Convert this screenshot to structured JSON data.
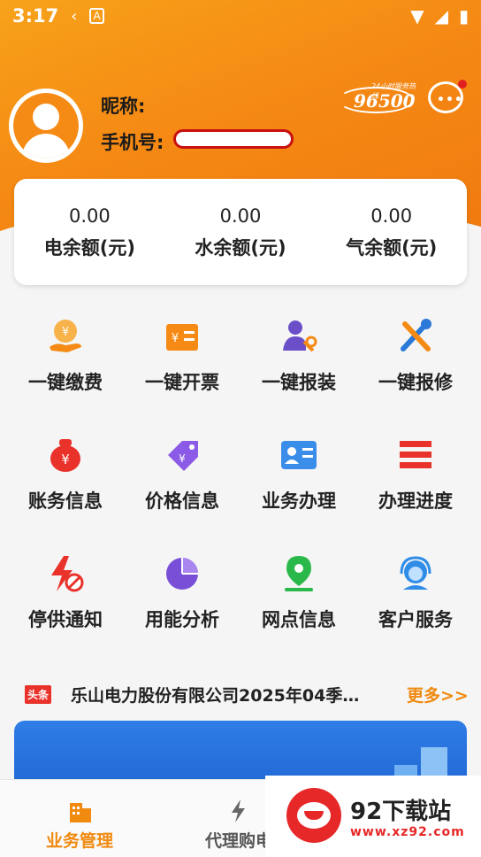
{
  "status_bar": {
    "time": "3:17",
    "notif_icon_a": "A"
  },
  "profile": {
    "nickname_label": "昵称:",
    "phone_label": "手机号:"
  },
  "hotline": {
    "small_text": "24小时服务热线",
    "number": "96500"
  },
  "balances": [
    {
      "value": "0.00",
      "label": "电余额(元)"
    },
    {
      "value": "0.00",
      "label": "水余额(元)"
    },
    {
      "value": "0.00",
      "label": "气余额(元)"
    }
  ],
  "grid": [
    {
      "label": "一键缴费",
      "icon": "payment-icon"
    },
    {
      "label": "一键开票",
      "icon": "invoice-icon"
    },
    {
      "label": "一键报装",
      "icon": "install-icon"
    },
    {
      "label": "一键报修",
      "icon": "repair-icon"
    },
    {
      "label": "账务信息",
      "icon": "bill-icon"
    },
    {
      "label": "价格信息",
      "icon": "price-tag-icon"
    },
    {
      "label": "业务办理",
      "icon": "id-card-icon"
    },
    {
      "label": "办理进度",
      "icon": "progress-list-icon"
    },
    {
      "label": "停供通知",
      "icon": "power-off-icon"
    },
    {
      "label": "用能分析",
      "icon": "pie-chart-icon"
    },
    {
      "label": "网点信息",
      "icon": "location-pin-icon"
    },
    {
      "label": "客户服务",
      "icon": "headset-icon"
    }
  ],
  "news": {
    "tag": "头条",
    "text": "乐山电力股份有限公司2025年04季…",
    "more": "更多>>"
  },
  "tabs": [
    {
      "label": "业务管理",
      "icon": "building-icon"
    },
    {
      "label": "代理购电",
      "icon": "lightning-icon"
    }
  ],
  "watermark": {
    "name": "92下载站",
    "url": "www.xz92.com"
  },
  "colors": {
    "accent": "#f08a10",
    "header": "#f58a14",
    "tag_red": "#e8322a"
  }
}
